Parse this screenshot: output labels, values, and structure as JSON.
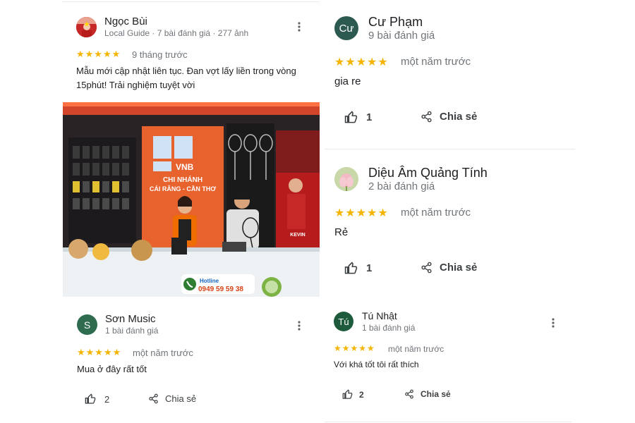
{
  "reviews": [
    {
      "name": "Ngọc Bùi",
      "meta": "Local Guide · 7 bài đánh giá · 277 ảnh",
      "stars": "★★★★★",
      "date": "9 tháng trước",
      "text_line1": "Mẫu mới cập nhật liên tục. Đan vợt lấy liền trong vòng",
      "text_line2": "15phút! Trải nghiệm tuyệt vời",
      "photo": {
        "logo": "VNB",
        "sign_line1": "CHI NHÁNH",
        "sign_line2": "CÁI RĂNG - CẦN THƠ",
        "hotline_label": "Hotline",
        "hotline_number": "0949 59 59 38",
        "poster_name": "KEVIN"
      }
    },
    {
      "name": "Sơn Music",
      "initial": "S",
      "avatar_color": "#2e6b4f",
      "meta": "1 bài đánh giá",
      "stars": "★★★★★",
      "date": "một năm trước",
      "text": "Mua ở đây rất tốt",
      "likes": "2",
      "share": "Chia sẻ"
    },
    {
      "name": "Cư Phạm",
      "initial": "Cư",
      "avatar_color": "#2d5a50",
      "meta": "9 bài đánh giá",
      "stars": "★★★★★",
      "date": "một năm trước",
      "text": "gia re",
      "likes": "1",
      "share": "Chia sẻ"
    },
    {
      "name": "Diệu Âm Quảng Tính",
      "meta": "2 bài đánh giá",
      "stars": "★★★★★",
      "date": "một năm trước",
      "text": "Rẻ",
      "likes": "1",
      "share": "Chia sẻ"
    },
    {
      "name": "Tú Nhật",
      "initial": "Tú",
      "avatar_color": "#1e5a3c",
      "meta": "1 bài đánh giá",
      "stars": "★★★★★",
      "date": "một năm trước",
      "text": "Với khá tốt tôi rất thích",
      "likes": "2",
      "share": "Chia sẻ"
    }
  ],
  "icons": {
    "more": "more-vert-icon",
    "like": "thumb-up-icon",
    "share": "share-icon"
  },
  "colors": {
    "star": "#f4b400",
    "meta": "#70757a",
    "text": "#202124",
    "divider": "#e8eaed"
  }
}
